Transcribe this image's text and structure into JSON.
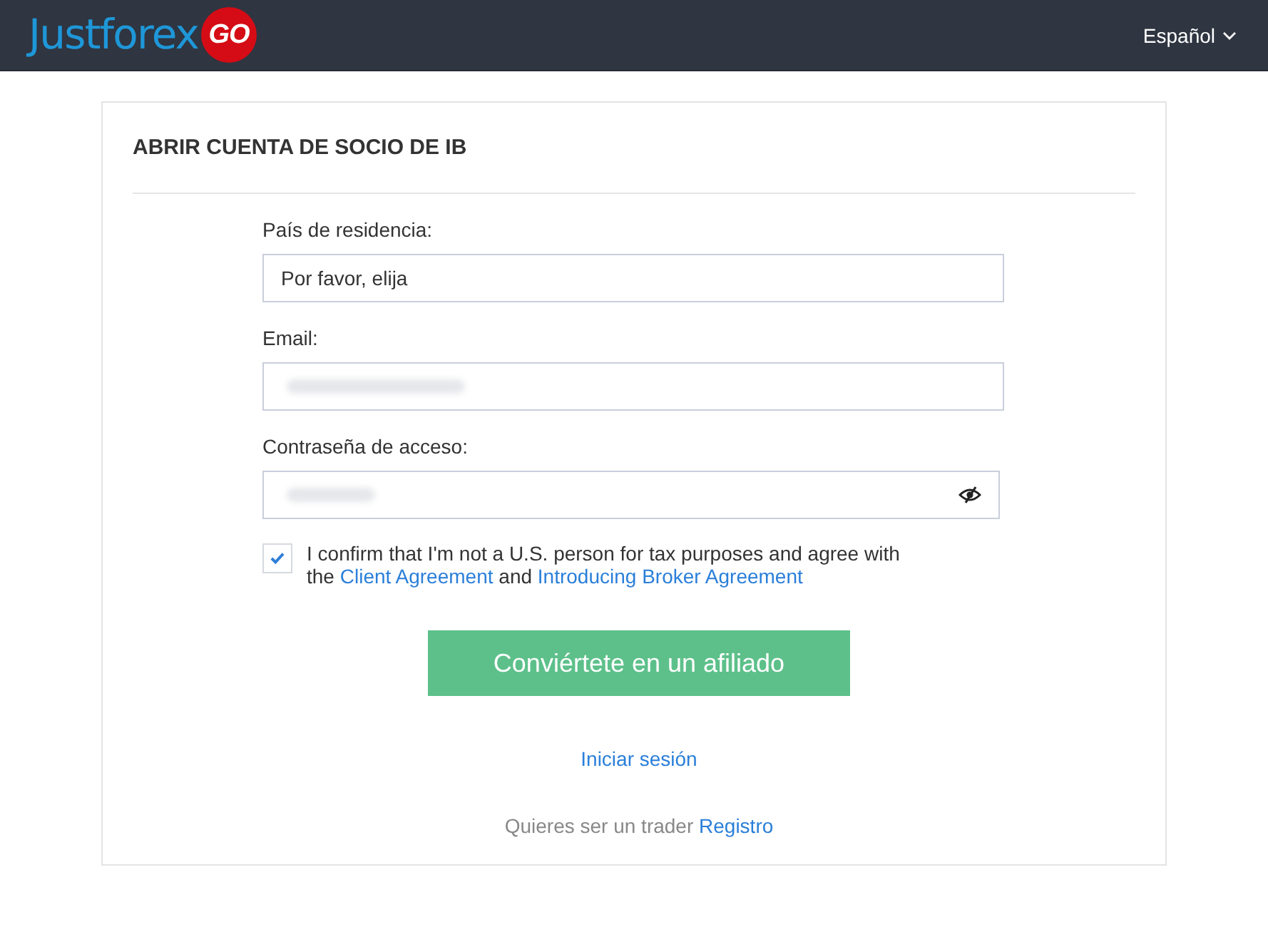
{
  "header": {
    "logo": {
      "name": "Justforex",
      "badge": "GO"
    },
    "language": {
      "label": "Español"
    }
  },
  "card": {
    "title": "ABRIR CUENTA DE SOCIO DE IB",
    "fields": [
      {
        "kind": "select",
        "label": "País de residencia:",
        "value": "Por favor, elija",
        "redacted": false
      },
      {
        "kind": "email",
        "label": "Email:",
        "redacted": true
      },
      {
        "kind": "password",
        "label": "Contraseña de acceso:",
        "redacted": true
      }
    ],
    "consent": {
      "checked": true,
      "text": "I confirm that I'm not a U.S. person for tax purposes and agree with the",
      "link_1": "Client Agreement",
      "joiner": "and",
      "link_2": "Introducing Broker Agreement"
    },
    "submit": "Conviértete en un afiliado",
    "login_link": "Iniciar sesión",
    "trader": {
      "text": "Quieres ser un trader",
      "link": "Registro"
    }
  }
}
